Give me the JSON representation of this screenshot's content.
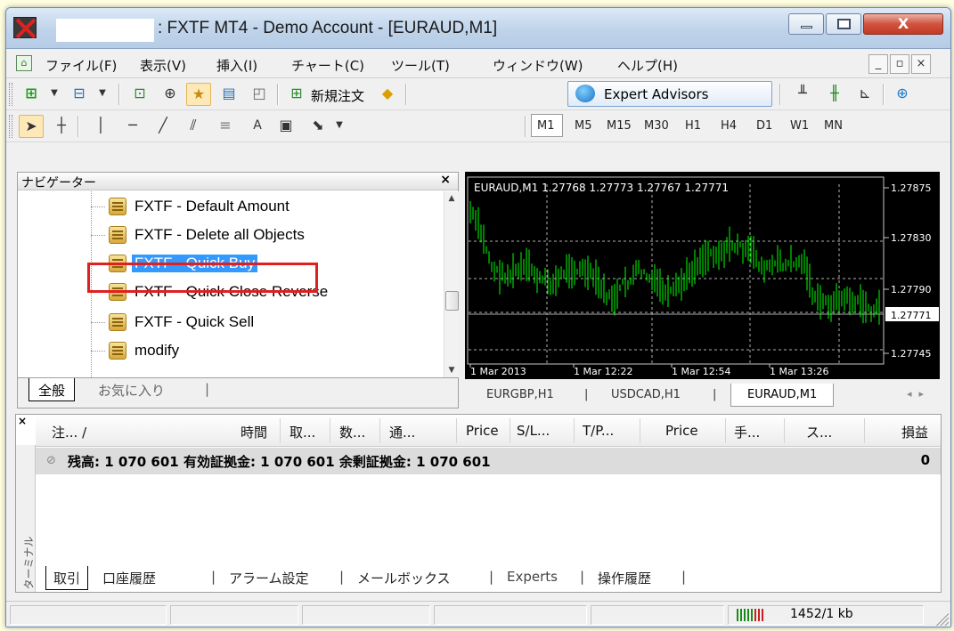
{
  "window": {
    "title": ": FXTF MT4 - Demo Account - [EURAUD,M1]",
    "close_glyph": "X"
  },
  "menu": {
    "items": [
      "ファイル(F)",
      "表示(V)",
      "挿入(I)",
      "チャート(C)",
      "ツール(T)",
      "ウィンドウ(W)",
      "ヘルプ(H)"
    ]
  },
  "toolbar": {
    "new_order_label": "新規注文",
    "expert_advisors_label": "Expert Advisors",
    "text_tool": "A",
    "timeframes": [
      "M1",
      "M5",
      "M15",
      "M30",
      "H1",
      "H4",
      "D1",
      "W1",
      "MN"
    ],
    "active_timeframe": "M1"
  },
  "navigator": {
    "title": "ナビゲーター",
    "items": [
      "FXTF - Default Amount",
      "FXTF - Delete all Objects",
      "FXTF - Quick Buy",
      "FXTF - Quick Close Reverse",
      "FXTF - Quick Sell",
      "modify"
    ],
    "selected_index": 2,
    "tabs": [
      "全般",
      "お気に入り"
    ],
    "active_tab": "全般"
  },
  "chart": {
    "header": "EURAUD,M1  1.27768 1.27773 1.27767 1.27771",
    "price_labels": [
      "1.27875",
      "1.27830",
      "1.27790",
      "1.27745"
    ],
    "current_price": "1.27771",
    "time_labels": [
      "1 Mar 2013",
      "1 Mar 12:22",
      "1 Mar 12:54",
      "1 Mar 13:26"
    ],
    "bar_color": "#00ff00",
    "background": "#000000",
    "tabs": [
      "EURGBP,H1",
      "USDCAD,H1",
      "EURAUD,M1"
    ],
    "active_tab": "EURAUD,M1"
  },
  "terminal": {
    "side_label": "ターミナル",
    "columns": [
      "注... /",
      "時間",
      "取...",
      "数...",
      "通...",
      "Price",
      "S/L...",
      "T/P...",
      "Price",
      "手...",
      "ス...",
      "損益"
    ],
    "balance_text": "残高: 1 070 601  有効証拠金: 1 070 601  余剰証拠金: 1 070 601",
    "profit": "0",
    "tabs": [
      "取引",
      "口座履歴",
      "アラーム設定",
      "メールボックス",
      "Experts",
      "操作履歴"
    ],
    "active_tab": "取引"
  },
  "status": {
    "traffic": "1452/1 kb"
  }
}
